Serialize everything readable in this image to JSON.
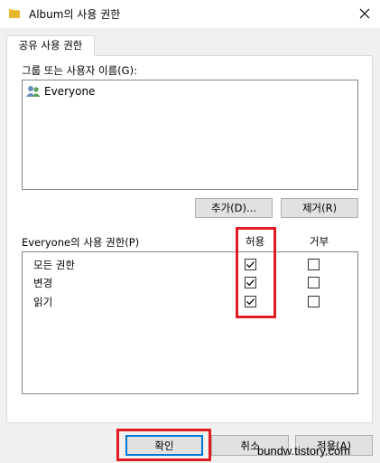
{
  "window": {
    "title": "Album의 사용 권한",
    "tab_label": "공유 사용 권한"
  },
  "group_section": {
    "label": "그룹 또는 사용자 이름(G):",
    "users": [
      {
        "name": "Everyone",
        "icon": "users-icon"
      }
    ],
    "add_button": "추가(D)...",
    "remove_button": "제거(R)"
  },
  "permissions": {
    "label": "Everyone의 사용 권한(P)",
    "allow_header": "허용",
    "deny_header": "거부",
    "rows": [
      {
        "name": "모든 권한",
        "allow": true,
        "deny": false
      },
      {
        "name": "변경",
        "allow": true,
        "deny": false
      },
      {
        "name": "읽기",
        "allow": true,
        "deny": false
      }
    ]
  },
  "footer": {
    "ok_button": "확인",
    "cancel_button": "취소",
    "apply_button": "적용(A)"
  },
  "watermark": "bundw.tistory.com",
  "colors": {
    "highlight": "#e21b23",
    "folder": "#f4c542",
    "default_button_border": "#0078d7"
  }
}
